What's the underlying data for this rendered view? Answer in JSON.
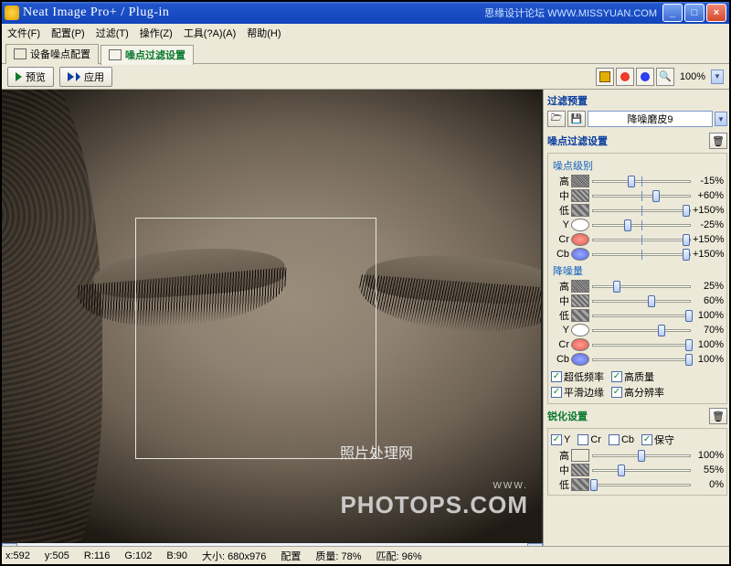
{
  "title": "Neat Image Pro+ / Plug-in",
  "badge": "思缘设计论坛   WWW.MISSYUAN.COM",
  "menu": [
    "文件(F)",
    "配置(P)",
    "过滤(T)",
    "操作(Z)",
    "工具(?A)(A)",
    "帮助(H)"
  ],
  "tabs": {
    "device": "设备噪点配置",
    "filter": "噪点过滤设置"
  },
  "toolbar": {
    "preview": "预览",
    "apply": "应用",
    "zoom": "100%"
  },
  "side": {
    "preset_title": "过滤预置",
    "preset_value": "降噪磨皮9",
    "filter_title": "噪点过滤设置",
    "level_title": "噪点级别",
    "amount_title": "降噪量",
    "rows_level": [
      {
        "lab": "高",
        "cls": "tex-h",
        "val": "-15%",
        "pos": 40,
        "tick": 50
      },
      {
        "lab": "中",
        "cls": "tex-m",
        "val": "+60%",
        "pos": 65,
        "tick": 50
      },
      {
        "lab": "低",
        "cls": "tex-l",
        "val": "+150%",
        "pos": 95,
        "tick": 50
      },
      {
        "lab": "Y",
        "cls": "cir cir-y",
        "val": "-25%",
        "pos": 36,
        "tick": 50
      },
      {
        "lab": "Cr",
        "cls": "cir cir-r",
        "val": "+150%",
        "pos": 95,
        "tick": 50
      },
      {
        "lab": "Cb",
        "cls": "cir cir-b",
        "val": "+150%",
        "pos": 95,
        "tick": 50
      }
    ],
    "rows_amount": [
      {
        "lab": "高",
        "cls": "tex-h",
        "val": "25%",
        "pos": 25
      },
      {
        "lab": "中",
        "cls": "tex-m",
        "val": "60%",
        "pos": 60
      },
      {
        "lab": "低",
        "cls": "tex-l",
        "val": "100%",
        "pos": 98
      },
      {
        "lab": "Y",
        "cls": "cir cir-y",
        "val": "70%",
        "pos": 70
      },
      {
        "lab": "Cr",
        "cls": "cir cir-r",
        "val": "100%",
        "pos": 98
      },
      {
        "lab": "Cb",
        "cls": "cir cir-b",
        "val": "100%",
        "pos": 98
      }
    ],
    "chk_vlow": "超低频率",
    "chk_hq": "高质量",
    "chk_smooth": "平滑边缘",
    "chk_hr": "高分辨率",
    "sharp_title": "锐化设置",
    "sharp_chk": {
      "y": "Y",
      "cr": "Cr",
      "cb": "Cb",
      "keep": "保守"
    },
    "rows_sharp": [
      {
        "lab": "高",
        "cls": "shp-h",
        "val": "100%",
        "pos": 50
      },
      {
        "lab": "中",
        "cls": "tex-m",
        "val": "55%",
        "pos": 30
      },
      {
        "lab": "低",
        "cls": "tex-l",
        "val": "0%",
        "pos": 2
      }
    ]
  },
  "watermark": {
    "small": "WWW.",
    "big": "PHOTOPS.COM",
    "cn": "照片处理网"
  },
  "status": {
    "x": "x:592",
    "y": "y:505",
    "r": "R:116",
    "g": "G:102",
    "b": "B:90",
    "size_lab": "大小:",
    "size_val": "680x976",
    "cfg": "配置",
    "q_lab": "质量:",
    "q_val": "78%",
    "m_lab": "匹配:",
    "m_val": "96%"
  }
}
